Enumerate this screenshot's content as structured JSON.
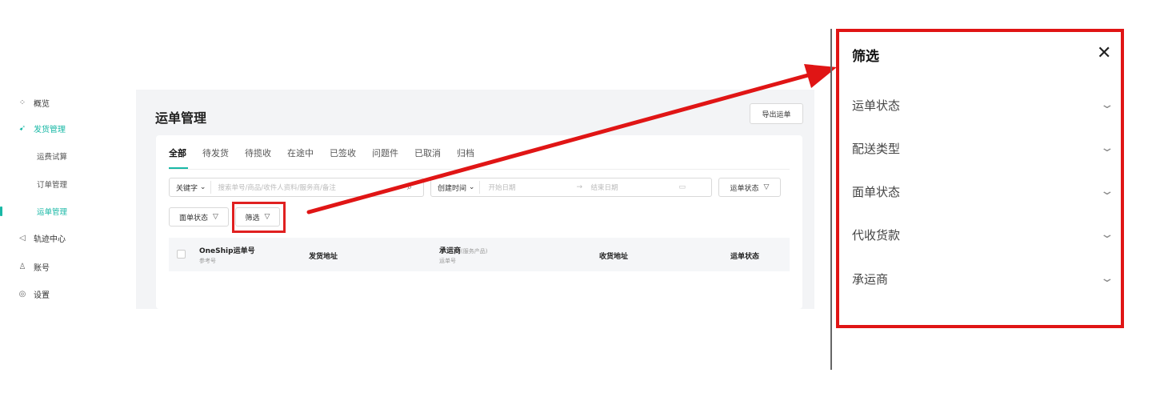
{
  "sidebar": {
    "items": [
      {
        "icon": "grid-icon",
        "label": "概览"
      },
      {
        "icon": "rocket-icon",
        "label": "发货管理"
      },
      {
        "icon": "send-icon",
        "label": "轨迹中心"
      },
      {
        "icon": "user-icon",
        "label": "账号"
      },
      {
        "icon": "settings-icon",
        "label": "设置"
      }
    ],
    "sub_items": [
      "运费试算",
      "订单管理",
      "运单管理"
    ],
    "accent": "#19b8a6"
  },
  "main": {
    "title": "运单管理",
    "export_label": "导出运单",
    "tabs": [
      "全部",
      "待发货",
      "待揽收",
      "在途中",
      "已签收",
      "问题件",
      "已取消",
      "归档"
    ],
    "keyword_select": "关键字",
    "keyword_placeholder": "搜索单号/商品/收件人资料/服务商/备注",
    "date_select": "创建时间",
    "date_start_placeholder": "开始日期",
    "date_end_placeholder": "结束日期",
    "waybill_status_filter": "运单状态",
    "face_status_filter": "面单状态",
    "sift_button": "筛选",
    "table": {
      "col1": "OneShip运单号",
      "col1_sub": "参考号",
      "col2": "发货地址",
      "col3": "承运商",
      "col3_mini": "(服务产品)",
      "col3_sub": "运单号",
      "col4": "收货地址",
      "col5": "运单状态"
    }
  },
  "filter_panel": {
    "title": "筛选",
    "rows": [
      "运单状态",
      "配送类型",
      "面单状态",
      "代收货款",
      "承运商"
    ]
  },
  "highlight_color": "#e02020"
}
